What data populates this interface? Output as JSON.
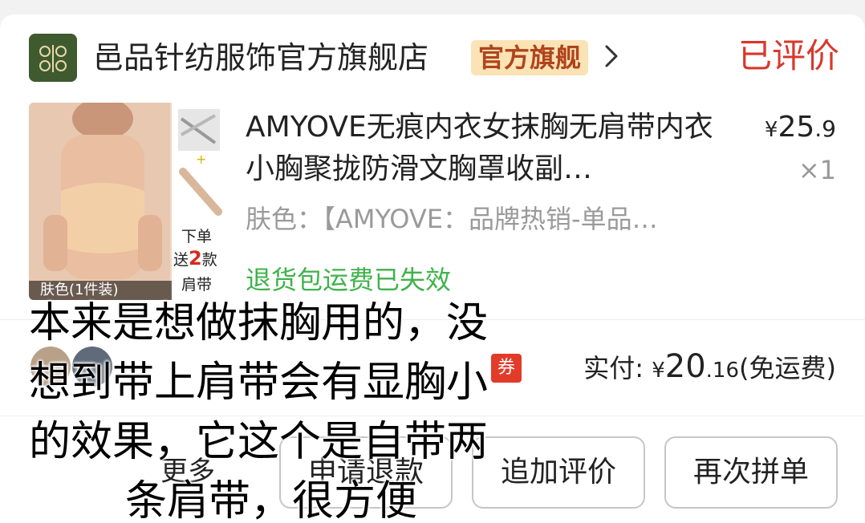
{
  "shop": {
    "name": "邑品针纺服饰官方旗舰店",
    "badge": "官方旗舰",
    "review_status": "已评价"
  },
  "product": {
    "title": "AMYOVE无痕内衣女抹胸无肩带内衣小胸聚拢防滑文胸罩收副…",
    "price_symbol": "¥",
    "price_int": "25",
    "price_dec": ".9",
    "quantity": "×1",
    "sku": "肤色：【AMYOVE：品牌热销-单品…",
    "image_label_color": "肤色(1件装)",
    "image_gift_l1": "下单",
    "image_gift_l2": "送",
    "image_gift_num": "2",
    "image_gift_l2b": "款",
    "image_gift_l3": "肩带",
    "return_note": "退货包运费已失效"
  },
  "payment": {
    "tag": "券",
    "label": "实付:",
    "symbol": "¥",
    "amount_int": "20",
    "amount_dec": ".16",
    "shipping_note": "(免运费)"
  },
  "actions": {
    "more": "更多",
    "refund": "申请退款",
    "add_review": "追加评价",
    "reorder": "再次拼单"
  },
  "caption": {
    "line1": "本来是想做抹胸用的，没",
    "line2": "想到带上肩带会有显胸小",
    "line3": "的效果，它这个是自带两",
    "line4": "条肩带，很方便"
  },
  "colors": {
    "accent_red": "#d8382c",
    "return_green": "#3fb24a",
    "badge_bg": "#fbe3b6"
  }
}
